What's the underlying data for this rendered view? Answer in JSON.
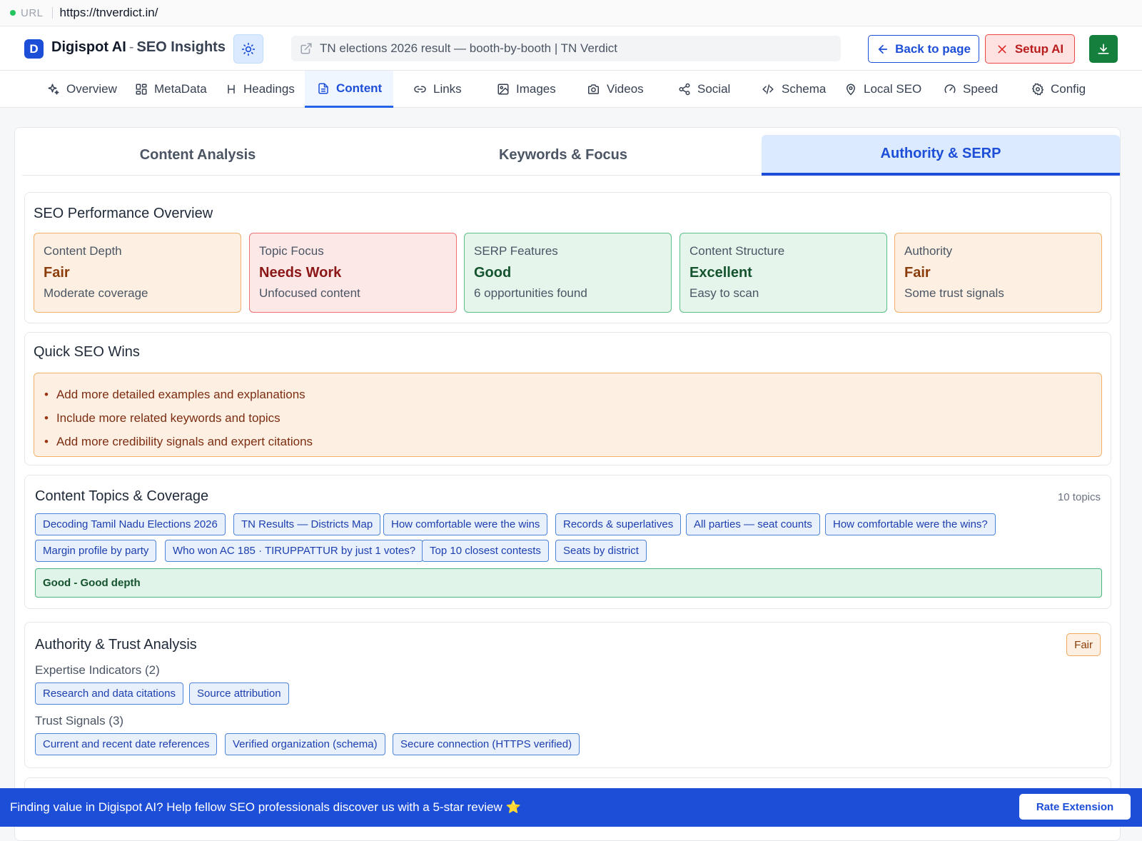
{
  "urlbar": {
    "label": "URL",
    "url": "https://tnverdict.in/"
  },
  "header": {
    "logo_letter": "D",
    "app_name": "Digispot AI",
    "separator": "-",
    "app_subtitle": "SEO Insights",
    "page_title": "TN elections 2026 result — booth-by-booth | TN Verdict",
    "back_label": "Back to page",
    "setup_label": "Setup AI"
  },
  "tabs": [
    {
      "label": "Overview",
      "icon": "sparkle-icon"
    },
    {
      "label": "MetaData",
      "icon": "grid-icon"
    },
    {
      "label": "Headings",
      "icon": "heading-icon"
    },
    {
      "label": "Content",
      "icon": "document-icon"
    },
    {
      "label": "Links",
      "icon": "link-icon"
    },
    {
      "label": "Images",
      "icon": "image-icon"
    },
    {
      "label": "Videos",
      "icon": "camera-icon"
    },
    {
      "label": "Social",
      "icon": "share-icon"
    },
    {
      "label": "Schema",
      "icon": "code-icon"
    },
    {
      "label": "Local SEO",
      "icon": "map-pin-icon"
    },
    {
      "label": "Speed",
      "icon": "gauge-icon"
    },
    {
      "label": "Config",
      "icon": "gear-icon"
    }
  ],
  "active_tab": "Content",
  "subtabs": [
    "Content Analysis",
    "Keywords & Focus",
    "Authority & SERP"
  ],
  "active_subtab": "Authority & SERP",
  "performance": {
    "title": "SEO Performance Overview",
    "metrics": [
      {
        "label": "Content Depth",
        "value": "Fair",
        "desc": "Moderate coverage",
        "status": "fair"
      },
      {
        "label": "Topic Focus",
        "value": "Needs Work",
        "desc": "Unfocused content",
        "status": "bad"
      },
      {
        "label": "SERP Features",
        "value": "Good",
        "desc": "6 opportunities found",
        "status": "good"
      },
      {
        "label": "Content Structure",
        "value": "Excellent",
        "desc": "Easy to scan",
        "status": "good"
      },
      {
        "label": "Authority",
        "value": "Fair",
        "desc": "Some trust signals",
        "status": "fair"
      }
    ]
  },
  "quick_wins": {
    "title": "Quick SEO Wins",
    "items": [
      "Add more detailed examples and explanations",
      "Include more related keywords and topics",
      "Add more credibility signals and expert citations"
    ]
  },
  "topics": {
    "title": "Content Topics & Coverage",
    "count": "10 topics",
    "row1": [
      "Decoding Tamil Nadu Elections 2026",
      "TN Results — Districts Map",
      "How comfortable were the wins",
      "Records & superlatives",
      "All parties — seat counts",
      "How comfortable were the wins?"
    ],
    "row2": [
      "Margin profile by party",
      "Who won AC 185 · TIRUPPATTUR by just 1 votes?",
      "Top 10 closest contests",
      "Seats by district"
    ],
    "depth": "Good - Good depth"
  },
  "authority": {
    "title": "Authority & Trust Analysis",
    "badge": "Fair",
    "expertise_label": "Expertise Indicators (2)",
    "expertise": [
      "Research and data citations",
      "Source attribution"
    ],
    "trust_label": "Trust Signals (3)",
    "trust": [
      "Current and recent date references",
      "Verified organization (schema)",
      "Secure connection (HTTPS verified)"
    ]
  },
  "banner": {
    "text": "Finding value in Digispot AI? Help fellow SEO professionals discover us with a 5-star review ⭐",
    "button": "Rate Extension"
  },
  "colors": {
    "accent": "#1d4ed8",
    "good": "#14532d",
    "fair": "#8a3d0a",
    "bad": "#8b1717",
    "download": "#15803d"
  }
}
